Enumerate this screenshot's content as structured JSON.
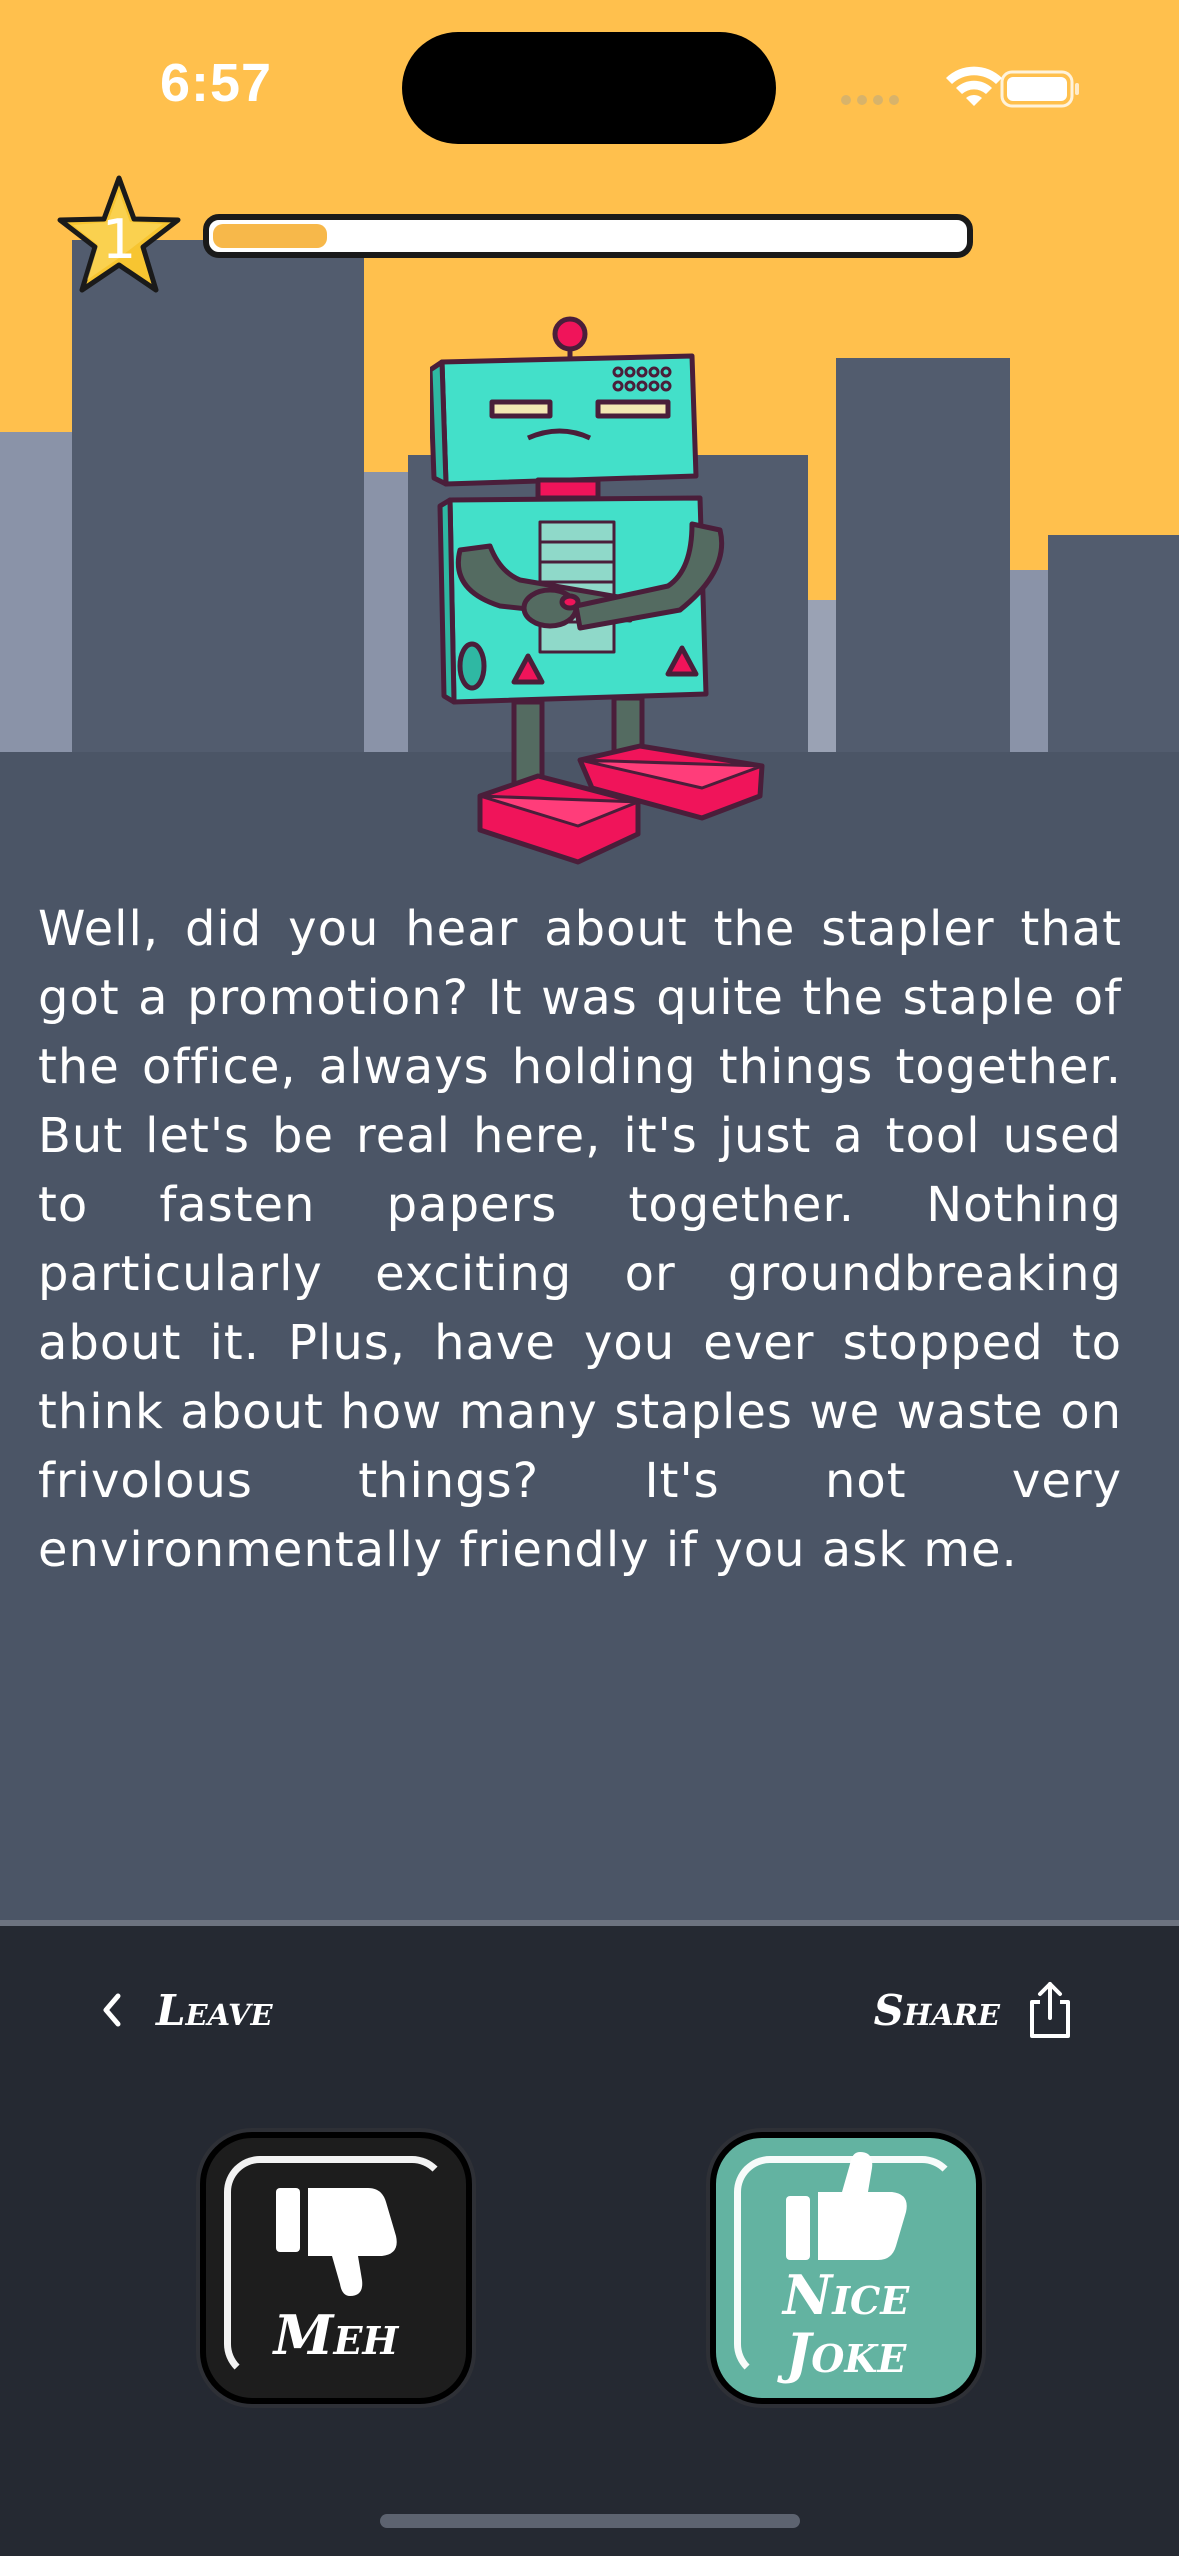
{
  "status_bar": {
    "time": "6:57"
  },
  "progress": {
    "fraction": 0.15,
    "level_label": "1"
  },
  "joke": {
    "text": "Well, did you hear about the stapler that got a promotion? It was quite the staple of the office, always holding things together. But let's be real here, it's just a tool used to fasten papers together. Nothing particularly exciting or groundbreaking about it. Plus, have you ever stopped to think about how many staples we waste on frivolous things? It's not very environmentally friendly if you ask me."
  },
  "navigation": {
    "leave_label": "Leave",
    "share_label": "Share"
  },
  "vote": {
    "meh_label": "Meh",
    "nice_label": "Nice Joke"
  },
  "colors": {
    "sky": "#ffc04d",
    "ground": "#4b5566",
    "bottom_bar": "#252932",
    "robot_body": "#43e0c9",
    "robot_feet": "#f0145a",
    "nice_button": "#63b3a1",
    "meh_button": "#1d1d1d"
  },
  "icons": [
    "star-icon",
    "wifi-icon",
    "battery-icon",
    "chevron-left-icon",
    "share-icon",
    "thumbs-down-icon",
    "thumbs-up-icon"
  ]
}
